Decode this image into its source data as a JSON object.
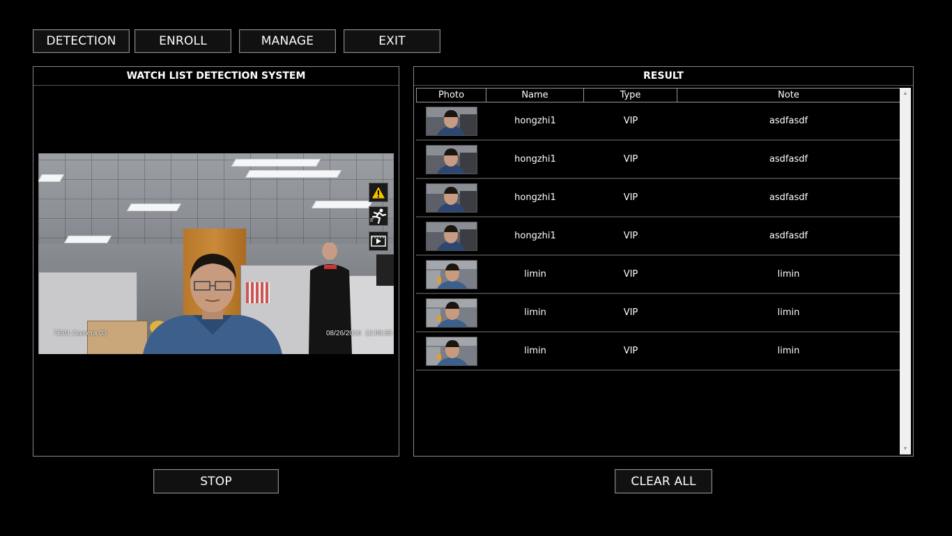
{
  "toolbar": {
    "detection": "DETECTION",
    "enroll": "ENROLL",
    "manage": "MANAGE",
    "exit": "EXIT"
  },
  "left_panel": {
    "title": "WATCH LIST DETECTION SYSTEM",
    "camera_label": "TE01 Camera 03",
    "timestamp": "08/26/2016  12:03:35",
    "icons": [
      "warning-icon",
      "running-person-icon",
      "video-playback-icon"
    ]
  },
  "right_panel": {
    "title": "RESULT",
    "columns": [
      "Photo",
      "Name",
      "Type",
      "Note"
    ],
    "rows": [
      {
        "photo": "hongzhi-face-thumbnail",
        "name": "hongzhi1",
        "type": "VIP",
        "note": "asdfasdf"
      },
      {
        "photo": "hongzhi-face-thumbnail",
        "name": "hongzhi1",
        "type": "VIP",
        "note": "asdfasdf"
      },
      {
        "photo": "hongzhi-face-thumbnail",
        "name": "hongzhi1",
        "type": "VIP",
        "note": "asdfasdf"
      },
      {
        "photo": "hongzhi-face-thumbnail",
        "name": "hongzhi1",
        "type": "VIP",
        "note": "asdfasdf"
      },
      {
        "photo": "limin-face-thumbnail",
        "name": "limin",
        "type": "VIP",
        "note": "limin"
      },
      {
        "photo": "limin-face-thumbnail",
        "name": "limin",
        "type": "VIP",
        "note": "limin"
      },
      {
        "photo": "limin-face-thumbnail",
        "name": "limin",
        "type": "VIP",
        "note": "limin"
      }
    ]
  },
  "buttons": {
    "stop": "STOP",
    "clear_all": "CLEAR ALL"
  },
  "colors": {
    "background": "#000000",
    "button_bg": "#111111",
    "border": "#8a8a8a",
    "warning": "#f2c200"
  }
}
